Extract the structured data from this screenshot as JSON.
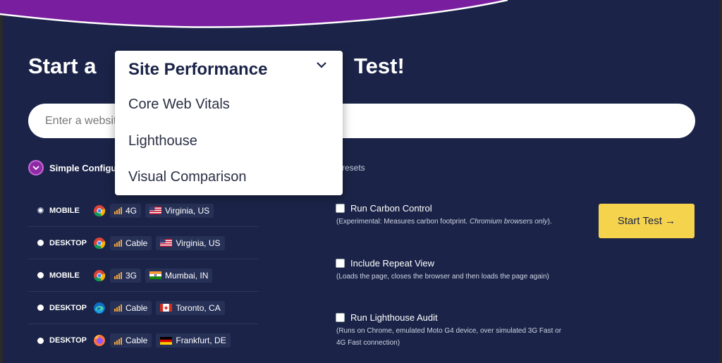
{
  "heading": {
    "prefix": "Start a",
    "suffix": "Test!"
  },
  "test_type": {
    "selected": "Site Performance",
    "options": [
      "Core Web Vitals",
      "Lighthouse",
      "Visual Comparison"
    ]
  },
  "url_input": {
    "placeholder": "Enter a website URL..."
  },
  "config": {
    "simple_label": "Simple Configuration",
    "presets_text": "resets"
  },
  "presets": [
    {
      "device": "MOBILE",
      "browser": "chrome-icon",
      "connection": "4G",
      "location": "Virginia, US",
      "flag": "us-flag-icon",
      "selected": true
    },
    {
      "device": "DESKTOP",
      "browser": "chrome-icon",
      "connection": "Cable",
      "location": "Virginia, US",
      "flag": "us-flag-icon",
      "selected": false
    },
    {
      "device": "MOBILE",
      "browser": "chrome-icon",
      "connection": "3G",
      "location": "Mumbai, IN",
      "flag": "in-flag-icon",
      "selected": false
    },
    {
      "device": "DESKTOP",
      "browser": "edge-icon",
      "connection": "Cable",
      "location": "Toronto, CA",
      "flag": "ca-flag-icon",
      "selected": false
    },
    {
      "device": "DESKTOP",
      "browser": "firefox-icon",
      "connection": "Cable",
      "location": "Frankfurt, DE",
      "flag": "de-flag-icon",
      "selected": false
    }
  ],
  "options": {
    "carbon": {
      "label": "Run Carbon Control",
      "desc": "(Experimental: Measures carbon footprint. ",
      "desc_italic": "Chromium browsers only",
      "desc_end": ")."
    },
    "repeat": {
      "label": "Include Repeat View",
      "desc": "(Loads the page, closes the browser and then loads the page again)"
    },
    "lighthouse": {
      "label": "Run Lighthouse Audit",
      "desc": "(Runs on Chrome, emulated Moto G4 device, over simulated 3G Fast or 4G Fast connection)"
    }
  },
  "start_button": {
    "label": "Start Test →"
  },
  "colors": {
    "background": "#1b2448",
    "accent_yellow": "#f6d34c",
    "accent_purple": "#8e2aa6"
  }
}
